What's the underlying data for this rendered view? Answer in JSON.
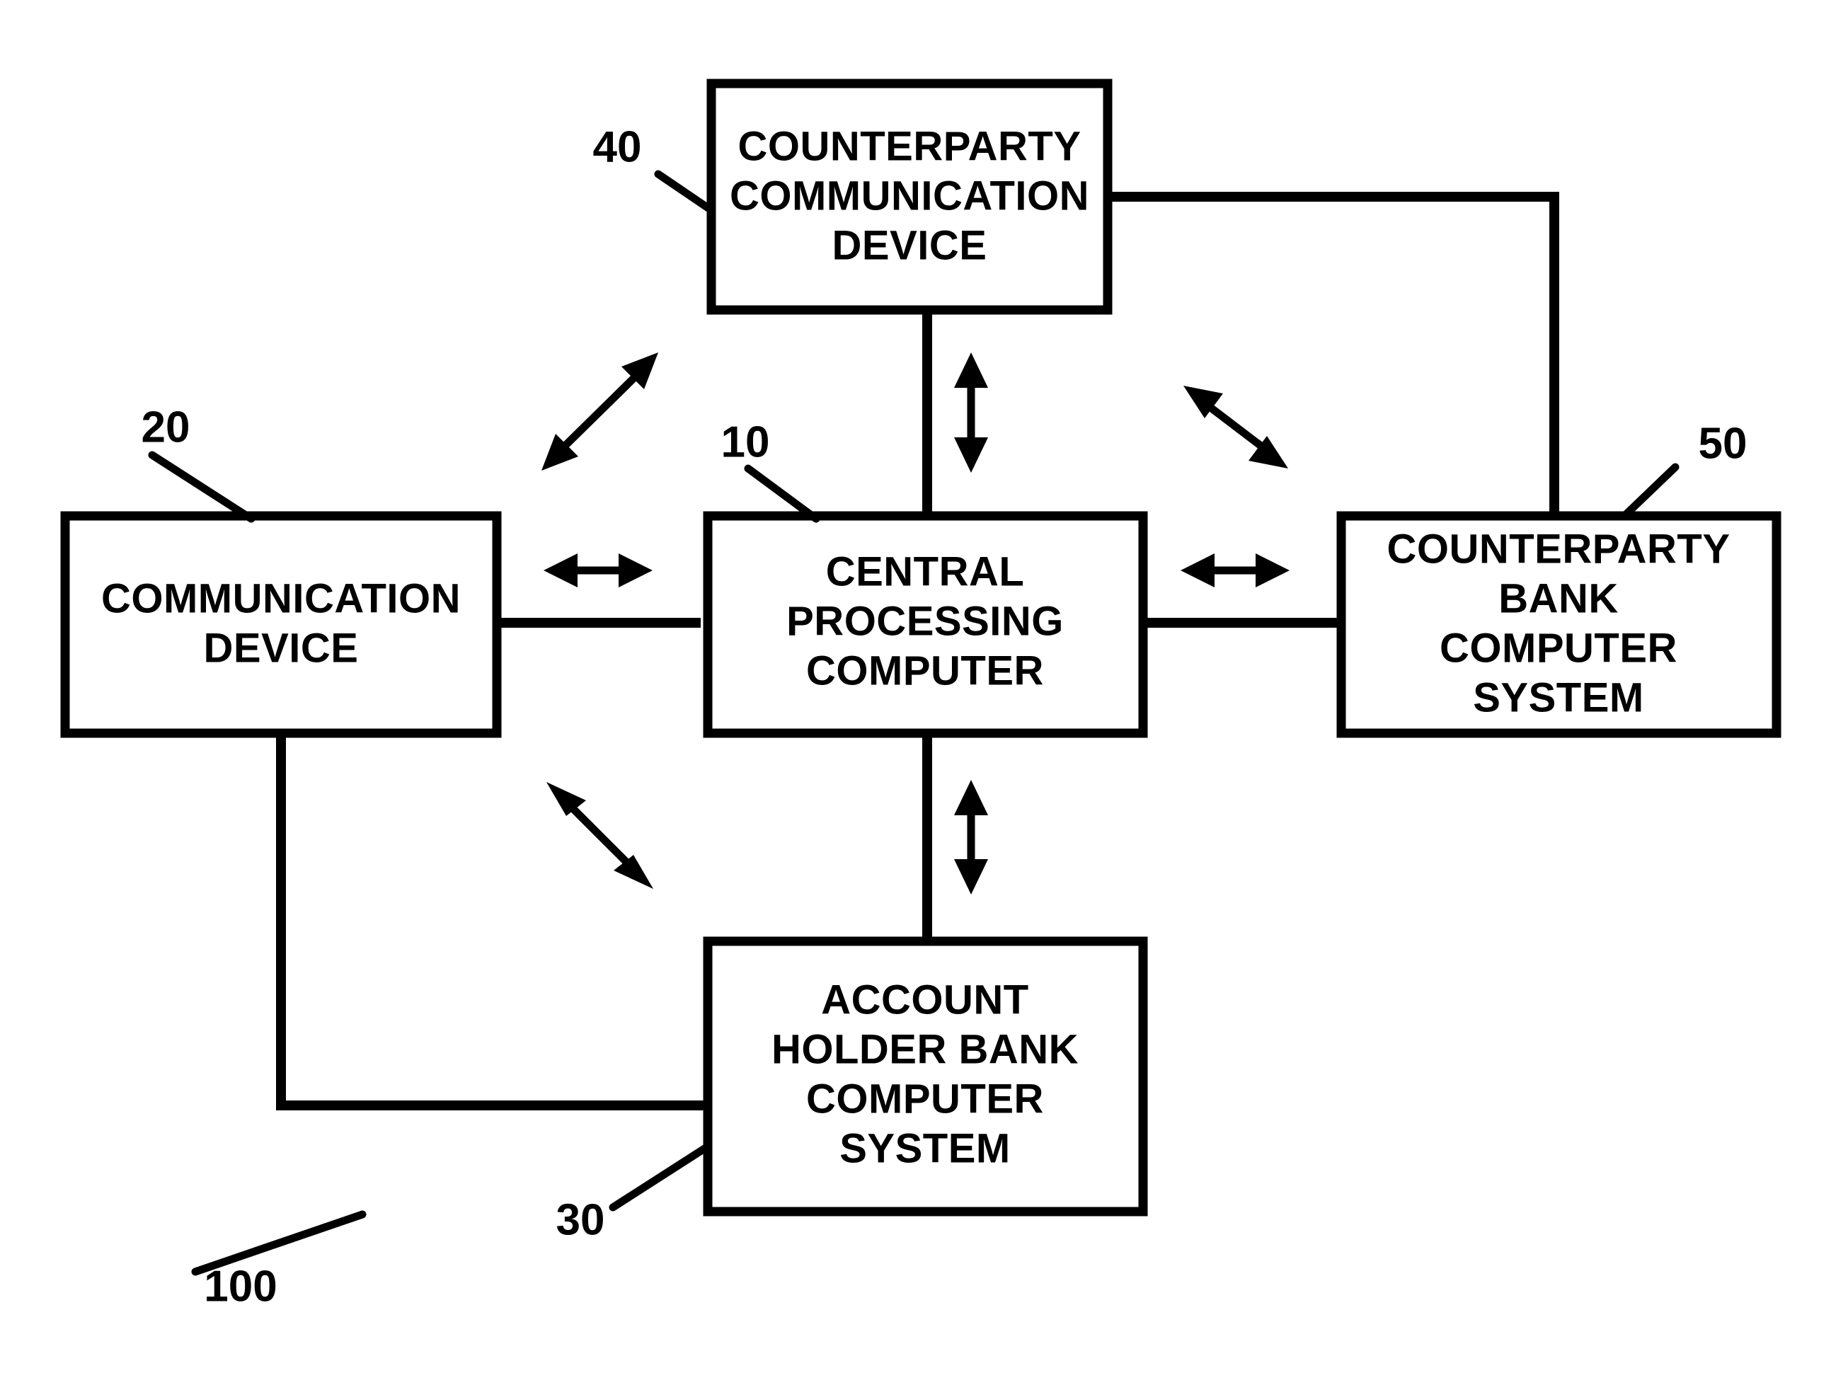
{
  "figure": {
    "title": "System block diagram",
    "background_color": "#ffffff",
    "line_color": "#000000"
  },
  "boxes": {
    "counterparty_communication_device": {
      "ref": "40",
      "lines": [
        "COUNTERPARTY",
        "COMMUNICATION",
        "DEVICE"
      ],
      "line1": "COUNTERPARTY",
      "line2": "COMMUNICATION",
      "line3": "DEVICE"
    },
    "communication_device": {
      "ref": "20",
      "lines": [
        "COMMUNICATION",
        "DEVICE"
      ],
      "line1": "COMMUNICATION",
      "line2": "DEVICE"
    },
    "central_processing_computer": {
      "ref": "10",
      "lines": [
        "CENTRAL",
        "PROCESSING",
        "COMPUTER"
      ],
      "line1": "CENTRAL",
      "line2": "PROCESSING",
      "line3": "COMPUTER"
    },
    "counterparty_bank_computer_system": {
      "ref": "50",
      "lines": [
        "COUNTERPARTY",
        "BANK",
        "COMPUTER",
        "SYSTEM"
      ],
      "line1": "COUNTERPARTY",
      "line2": "BANK",
      "line3": "COMPUTER",
      "line4": "SYSTEM"
    },
    "account_holder_bank_computer_system": {
      "ref": "30",
      "lines": [
        "ACCOUNT",
        "HOLDER BANK",
        "COMPUTER",
        "SYSTEM"
      ],
      "line1": "ACCOUNT",
      "line2": "HOLDER BANK",
      "line3": "COMPUTER",
      "line4": "SYSTEM"
    }
  },
  "reference_numerals": {
    "system": "100",
    "central_processing_computer": "10",
    "communication_device": "20",
    "account_holder_bank_computer_system": "30",
    "counterparty_communication_device": "40",
    "counterparty_bank_computer_system": "50"
  },
  "connections": [
    {
      "name": "communication-device-to-central-processing-computer",
      "style": "solid-line",
      "from": "COMMUNICATION DEVICE",
      "to": "CENTRAL PROCESSING COMPUTER"
    },
    {
      "name": "central-processing-computer-to-counterparty-bank",
      "style": "solid-line",
      "from": "CENTRAL PROCESSING COMPUTER",
      "to": "COUNTERPARTY BANK COMPUTER SYSTEM"
    },
    {
      "name": "counterparty-communication-device-to-central-processing-computer",
      "style": "solid-line",
      "from": "COUNTERPARTY COMMUNICATION DEVICE",
      "to": "CENTRAL PROCESSING COMPUTER"
    },
    {
      "name": "central-processing-computer-to-account-holder-bank",
      "style": "solid-line",
      "from": "CENTRAL PROCESSING COMPUTER",
      "to": "ACCOUNT HOLDER BANK COMPUTER SYSTEM"
    },
    {
      "name": "counterparty-communication-device-to-counterparty-bank",
      "style": "routed-line",
      "from": "COUNTERPARTY COMMUNICATION DEVICE",
      "to": "COUNTERPARTY BANK COMPUTER SYSTEM"
    },
    {
      "name": "communication-device-to-account-holder-bank",
      "style": "routed-line",
      "from": "COMMUNICATION DEVICE",
      "to": "ACCOUNT HOLDER BANK COMPUTER SYSTEM"
    }
  ],
  "arrows": [
    {
      "name": "arrow-communication-device-counterparty-communication-device",
      "direction": "bidirectional-diagonal-up-right"
    },
    {
      "name": "arrow-central-processing-computer-counterparty-communication-device",
      "direction": "bidirectional-vertical"
    },
    {
      "name": "arrow-counterparty-communication-device-counterparty-bank",
      "direction": "bidirectional-diagonal-down-right"
    },
    {
      "name": "arrow-communication-device-central-processing-computer",
      "direction": "bidirectional-horizontal"
    },
    {
      "name": "arrow-central-processing-computer-counterparty-bank",
      "direction": "bidirectional-horizontal"
    },
    {
      "name": "arrow-communication-device-account-holder-bank",
      "direction": "bidirectional-diagonal-down-right"
    },
    {
      "name": "arrow-central-processing-computer-account-holder-bank",
      "direction": "bidirectional-vertical"
    }
  ]
}
